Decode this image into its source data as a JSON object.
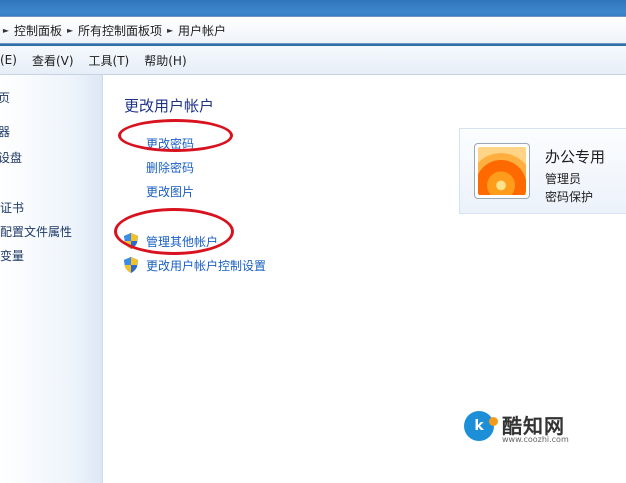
{
  "breadcrumb": {
    "items": [
      "控制面板",
      "所有控制面板项",
      "用户帐户"
    ]
  },
  "menu": {
    "items": [
      "(E)",
      "查看(V)",
      "工具(T)",
      "帮助(H)"
    ]
  },
  "sidebar": {
    "items": [
      "页",
      "器",
      "设盘",
      "密证书",
      "户配置文件属性",
      "境变量"
    ]
  },
  "main": {
    "title": "更改用户帐户",
    "links": [
      "更改密码",
      "删除密码",
      "更改图片"
    ],
    "admin_links": [
      "管理其他帐户",
      "更改用户帐户控制设置"
    ]
  },
  "user_card": {
    "name": "办公专用",
    "role": "管理员",
    "status": "密码保护"
  },
  "watermark": {
    "logo": "k",
    "title": "酷知网",
    "url": "www.coozhi.com"
  },
  "colors": {
    "link": "#1a5fc2",
    "title": "#1e3287",
    "annotation": "#d8121e"
  }
}
